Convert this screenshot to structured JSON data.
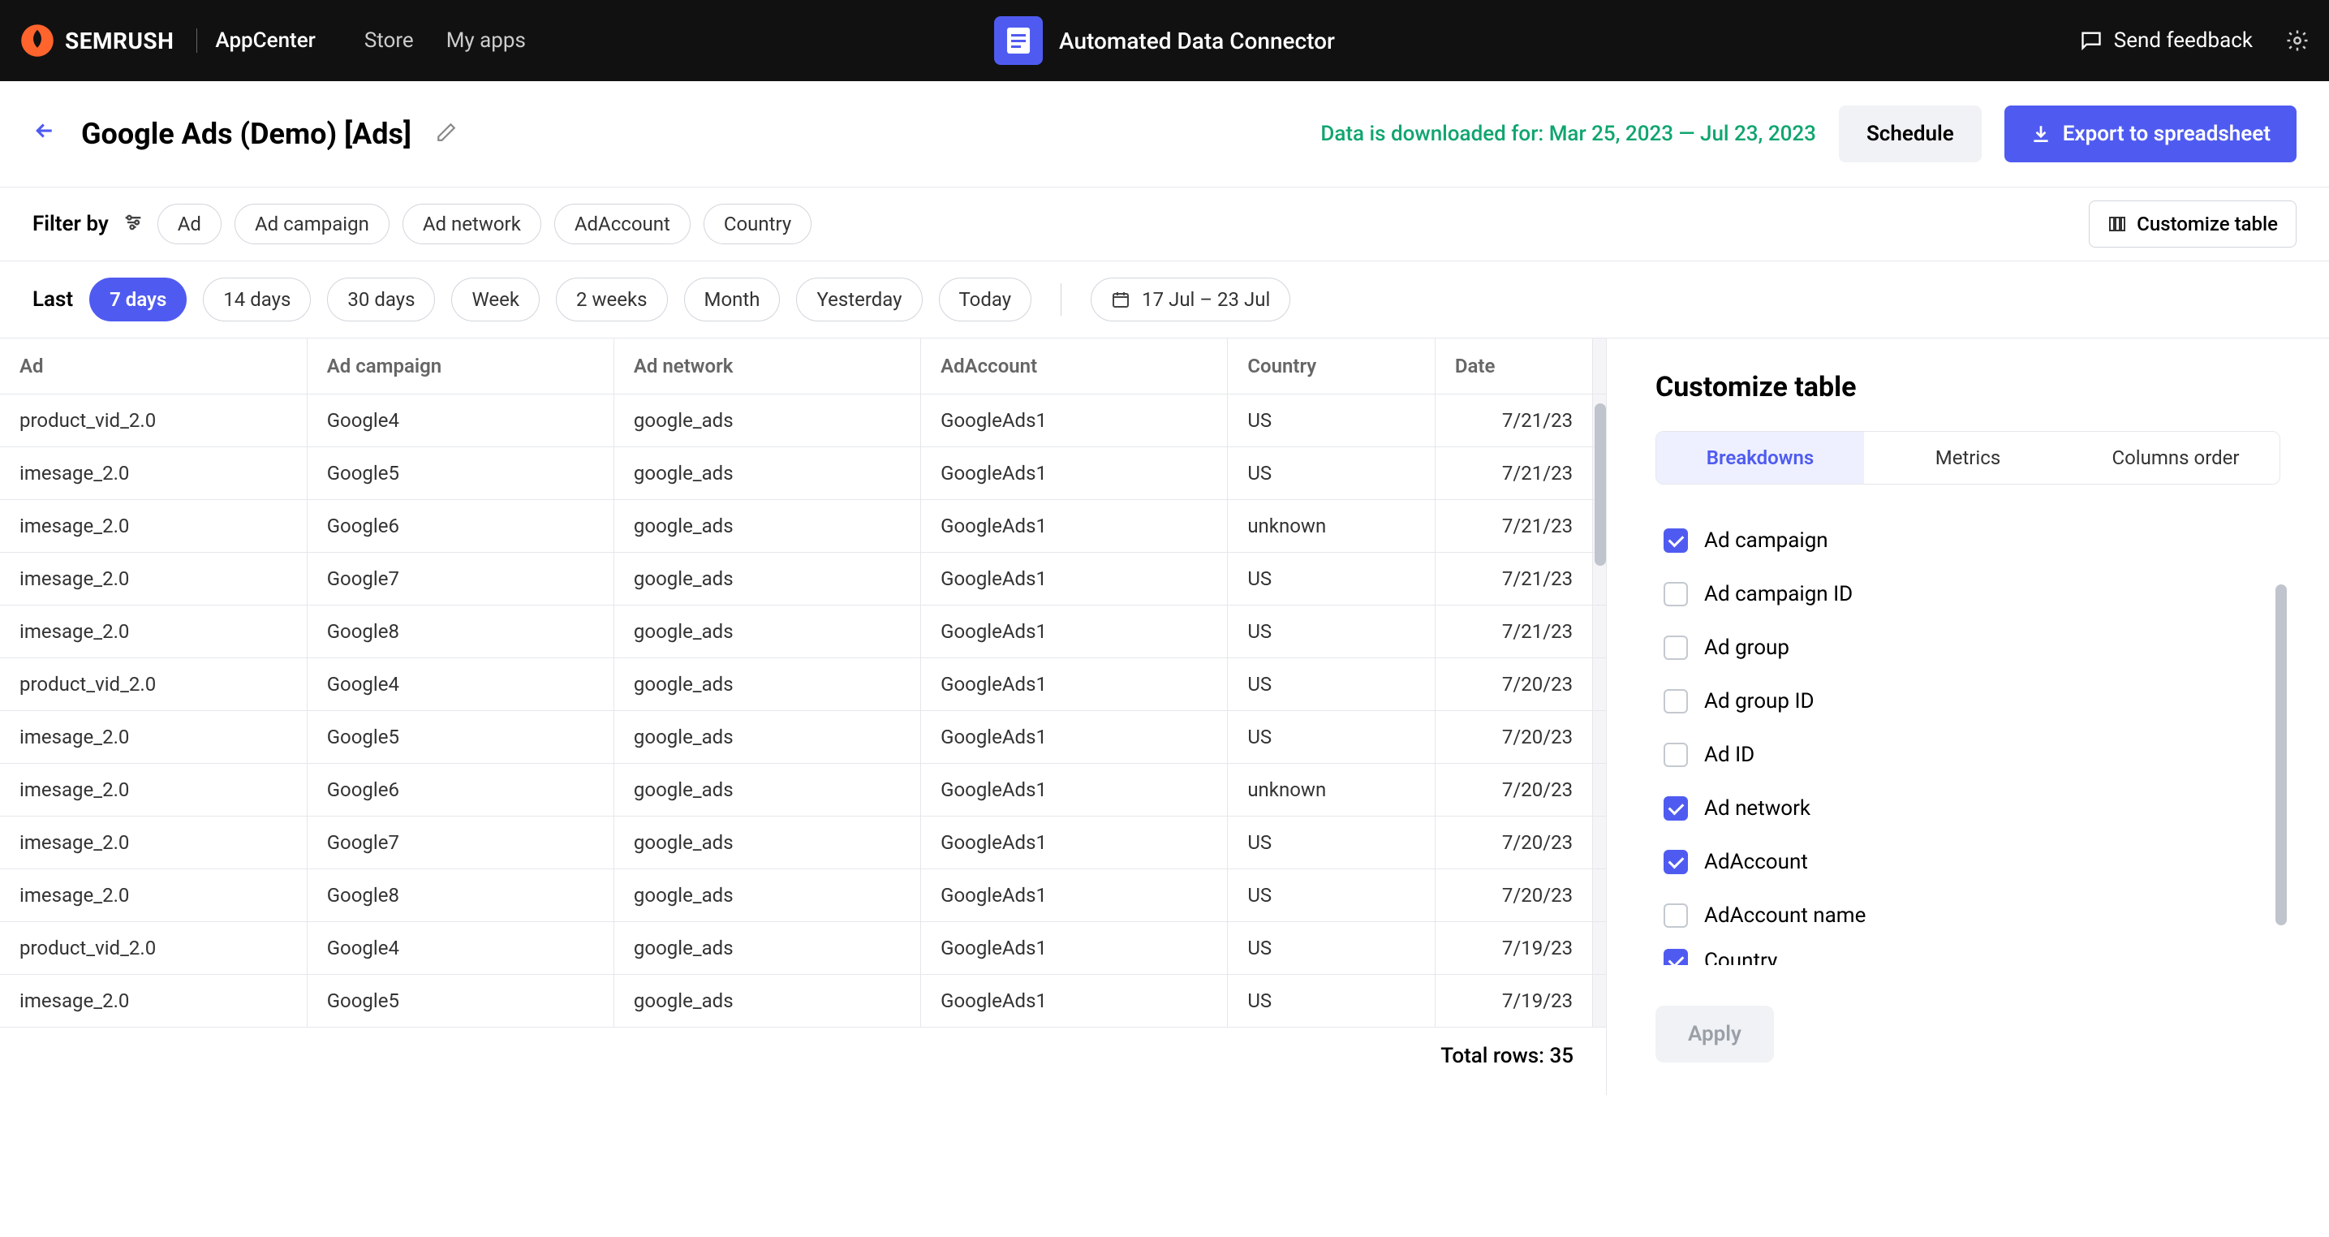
{
  "topbar": {
    "brand": "SEMRUSH",
    "appcenter": "AppCenter",
    "nav": {
      "store": "Store",
      "myapps": "My apps"
    },
    "app_title": "Automated Data Connector",
    "feedback": "Send feedback"
  },
  "subheader": {
    "title": "Google Ads (Demo) [Ads]",
    "status": "Data is downloaded for: Mar 25, 2023 — Jul 23, 2023",
    "schedule": "Schedule",
    "export": "Export to spreadsheet"
  },
  "filters": {
    "label": "Filter by",
    "chips": [
      "Ad",
      "Ad campaign",
      "Ad network",
      "AdAccount",
      "Country"
    ],
    "customize": "Customize table"
  },
  "dates": {
    "label": "Last",
    "items": [
      "7 days",
      "14 days",
      "30 days",
      "Week",
      "2 weeks",
      "Month",
      "Yesterday",
      "Today"
    ],
    "range": "17 Jul – 23 Jul"
  },
  "table": {
    "headers": [
      "Ad",
      "Ad campaign",
      "Ad network",
      "AdAccount",
      "Country",
      "Date"
    ],
    "rows": [
      [
        "product_vid_2.0",
        "Google4",
        "google_ads",
        "GoogleAds1",
        "US",
        "7/21/23"
      ],
      [
        "imesage_2.0",
        "Google5",
        "google_ads",
        "GoogleAds1",
        "US",
        "7/21/23"
      ],
      [
        "imesage_2.0",
        "Google6",
        "google_ads",
        "GoogleAds1",
        "unknown",
        "7/21/23"
      ],
      [
        "imesage_2.0",
        "Google7",
        "google_ads",
        "GoogleAds1",
        "US",
        "7/21/23"
      ],
      [
        "imesage_2.0",
        "Google8",
        "google_ads",
        "GoogleAds1",
        "US",
        "7/21/23"
      ],
      [
        "product_vid_2.0",
        "Google4",
        "google_ads",
        "GoogleAds1",
        "US",
        "7/20/23"
      ],
      [
        "imesage_2.0",
        "Google5",
        "google_ads",
        "GoogleAds1",
        "US",
        "7/20/23"
      ],
      [
        "imesage_2.0",
        "Google6",
        "google_ads",
        "GoogleAds1",
        "unknown",
        "7/20/23"
      ],
      [
        "imesage_2.0",
        "Google7",
        "google_ads",
        "GoogleAds1",
        "US",
        "7/20/23"
      ],
      [
        "imesage_2.0",
        "Google8",
        "google_ads",
        "GoogleAds1",
        "US",
        "7/20/23"
      ],
      [
        "product_vid_2.0",
        "Google4",
        "google_ads",
        "GoogleAds1",
        "US",
        "7/19/23"
      ],
      [
        "imesage_2.0",
        "Google5",
        "google_ads",
        "GoogleAds1",
        "US",
        "7/19/23"
      ]
    ],
    "total": "Total rows: 35"
  },
  "panel": {
    "title": "Customize table",
    "tabs": [
      "Breakdowns",
      "Metrics",
      "Columns order"
    ],
    "options": [
      {
        "label": "Ad campaign",
        "checked": true
      },
      {
        "label": "Ad campaign ID",
        "checked": false
      },
      {
        "label": "Ad group",
        "checked": false
      },
      {
        "label": "Ad group ID",
        "checked": false
      },
      {
        "label": "Ad ID",
        "checked": false
      },
      {
        "label": "Ad network",
        "checked": true
      },
      {
        "label": "AdAccount",
        "checked": true
      },
      {
        "label": "AdAccount name",
        "checked": false
      },
      {
        "label": "Country",
        "checked": true
      }
    ],
    "apply": "Apply"
  }
}
